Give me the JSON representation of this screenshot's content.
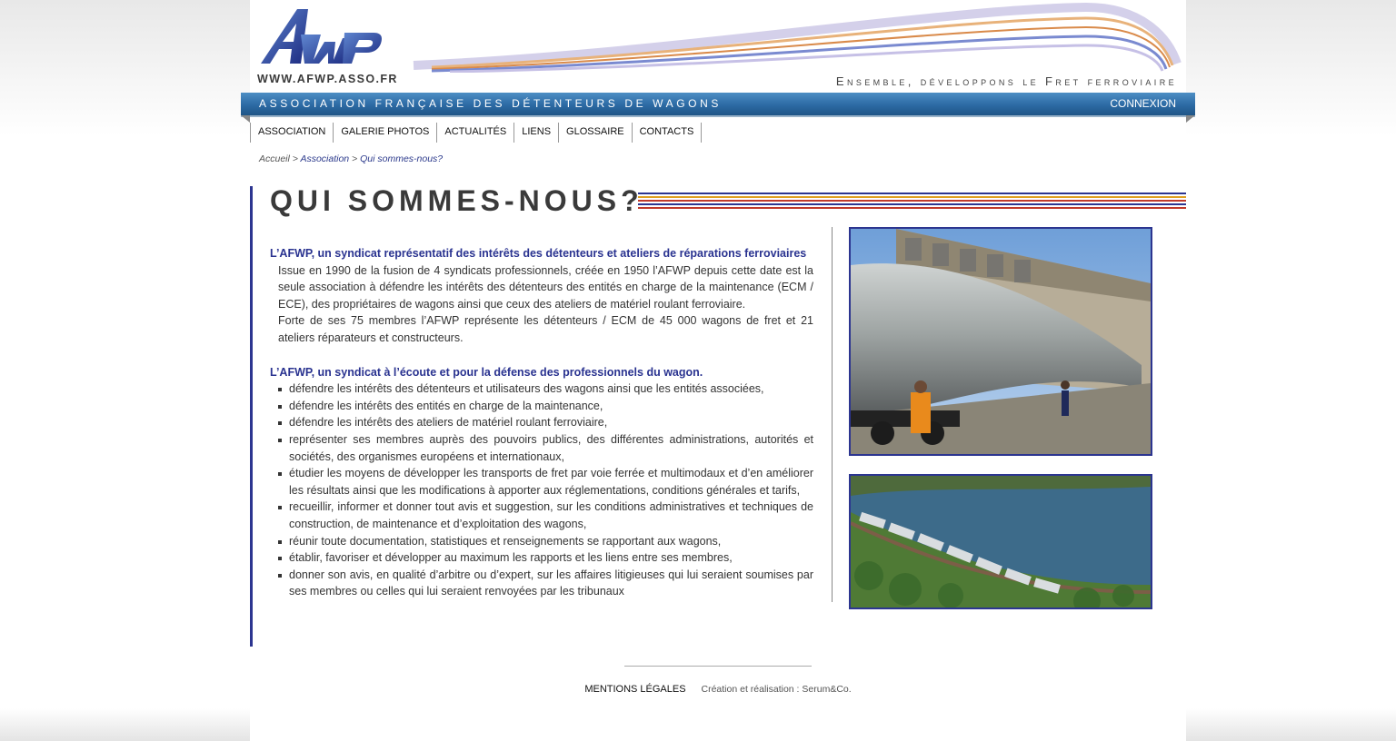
{
  "header": {
    "logo_text": "AWP",
    "site_url": "WWW.AFWP.ASSO.FR",
    "tagline": "Ensemble, développons le Fret ferroviaire"
  },
  "bar": {
    "assoc_name": "ASSOCIATION FRANÇAISE DES DÉTENTEURS DE WAGONS",
    "login_label": "CONNEXION"
  },
  "nav": {
    "items": [
      {
        "label": "ASSOCIATION"
      },
      {
        "label": "GALERIE PHOTOS"
      },
      {
        "label": "ACTUALITÉS"
      },
      {
        "label": "LIENS"
      },
      {
        "label": "GLOSSAIRE"
      },
      {
        "label": "CONTACTS"
      }
    ]
  },
  "breadcrumb": {
    "home": "Accueil",
    "sep1": " > ",
    "section": "Association",
    "sep2": " > ",
    "current": "Qui sommes-nous?"
  },
  "page": {
    "title": "QUI SOMMES-NOUS?",
    "section1": {
      "heading": "L’AFWP, un syndicat représentatif des intérêts des détenteurs et ateliers de réparations ferroviaires",
      "p1": "Issue en 1990 de la fusion de 4 syndicats professionnels, créée en 1950 l’AFWP depuis cette date est la seule association à défendre les intérêts des détenteurs des entités en charge de la maintenance (ECM / ECE), des propriétaires de wagons ainsi que ceux des ateliers de matériel roulant ferroviaire.",
      "p2": "Forte de ses 75 membres l’AFWP représente les détenteurs / ECM de 45 000 wagons de fret et 21 ateliers réparateurs et constructeurs."
    },
    "section2": {
      "heading": "L’AFWP, un syndicat à l’écoute et pour la défense des professionnels du wagon.",
      "items": [
        "défendre les intérêts des détenteurs et utilisateurs des wagons ainsi que les entités associées,",
        "défendre les intérêts des entités en charge de la maintenance,",
        "défendre les intérêts des ateliers de matériel roulant ferroviaire,",
        "représenter ses membres auprès des pouvoirs publics, des différentes administrations, autorités et sociétés, des organismes européens et internationaux,",
        "étudier les moyens de développer les transports de fret par voie ferrée et multimodaux et d’en améliorer les résultats ainsi que les modifications à apporter aux réglementations, conditions générales et tarifs,",
        "recueillir, informer et donner tout avis et suggestion, sur les conditions administratives et techniques de construction, de maintenance et d’exploitation des wagons,",
        "réunir toute documentation, statistiques et renseignements se rapportant aux wagons,",
        "établir, favoriser et développer au maximum les rapports et les liens entre ses membres,",
        "donner son avis, en qualité d’arbitre ou d’expert, sur les affaires litigieuses qui lui seraient soumises par ses membres ou celles qui lui seraient renvoyées par les tribunaux"
      ]
    }
  },
  "footer": {
    "mentions": "MENTIONS LÉGALES",
    "credits": "Création et réalisation : Serum&Co."
  },
  "colors": {
    "brand_blue": "#2c3590",
    "bar_blue": "#2c6aa4",
    "stripe_red": "#c0392b",
    "stripe_yellow": "#e0a020"
  }
}
